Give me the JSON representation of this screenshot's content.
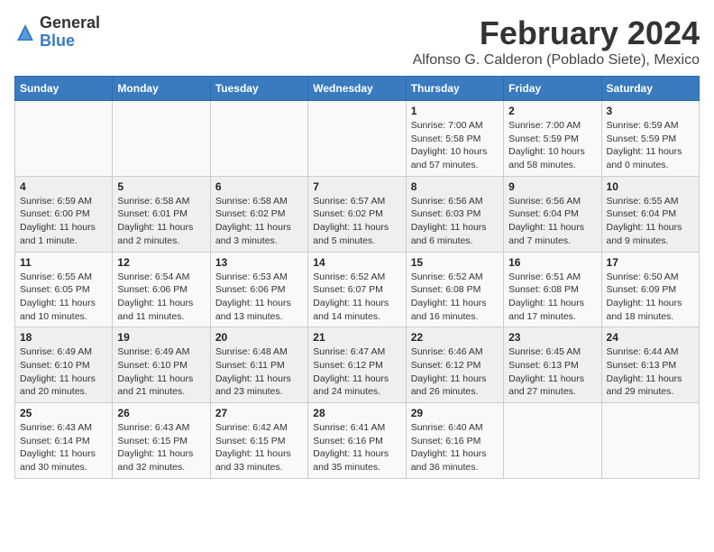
{
  "header": {
    "logo_line1": "General",
    "logo_line2": "Blue",
    "title": "February 2024",
    "subtitle": "Alfonso G. Calderon (Poblado Siete), Mexico"
  },
  "days_of_week": [
    "Sunday",
    "Monday",
    "Tuesday",
    "Wednesday",
    "Thursday",
    "Friday",
    "Saturday"
  ],
  "weeks": [
    [
      {
        "day": "",
        "info": ""
      },
      {
        "day": "",
        "info": ""
      },
      {
        "day": "",
        "info": ""
      },
      {
        "day": "",
        "info": ""
      },
      {
        "day": "1",
        "info": "Sunrise: 7:00 AM\nSunset: 5:58 PM\nDaylight: 10 hours\nand 57 minutes."
      },
      {
        "day": "2",
        "info": "Sunrise: 7:00 AM\nSunset: 5:59 PM\nDaylight: 10 hours\nand 58 minutes."
      },
      {
        "day": "3",
        "info": "Sunrise: 6:59 AM\nSunset: 5:59 PM\nDaylight: 11 hours\nand 0 minutes."
      }
    ],
    [
      {
        "day": "4",
        "info": "Sunrise: 6:59 AM\nSunset: 6:00 PM\nDaylight: 11 hours\nand 1 minute."
      },
      {
        "day": "5",
        "info": "Sunrise: 6:58 AM\nSunset: 6:01 PM\nDaylight: 11 hours\nand 2 minutes."
      },
      {
        "day": "6",
        "info": "Sunrise: 6:58 AM\nSunset: 6:02 PM\nDaylight: 11 hours\nand 3 minutes."
      },
      {
        "day": "7",
        "info": "Sunrise: 6:57 AM\nSunset: 6:02 PM\nDaylight: 11 hours\nand 5 minutes."
      },
      {
        "day": "8",
        "info": "Sunrise: 6:56 AM\nSunset: 6:03 PM\nDaylight: 11 hours\nand 6 minutes."
      },
      {
        "day": "9",
        "info": "Sunrise: 6:56 AM\nSunset: 6:04 PM\nDaylight: 11 hours\nand 7 minutes."
      },
      {
        "day": "10",
        "info": "Sunrise: 6:55 AM\nSunset: 6:04 PM\nDaylight: 11 hours\nand 9 minutes."
      }
    ],
    [
      {
        "day": "11",
        "info": "Sunrise: 6:55 AM\nSunset: 6:05 PM\nDaylight: 11 hours\nand 10 minutes."
      },
      {
        "day": "12",
        "info": "Sunrise: 6:54 AM\nSunset: 6:06 PM\nDaylight: 11 hours\nand 11 minutes."
      },
      {
        "day": "13",
        "info": "Sunrise: 6:53 AM\nSunset: 6:06 PM\nDaylight: 11 hours\nand 13 minutes."
      },
      {
        "day": "14",
        "info": "Sunrise: 6:52 AM\nSunset: 6:07 PM\nDaylight: 11 hours\nand 14 minutes."
      },
      {
        "day": "15",
        "info": "Sunrise: 6:52 AM\nSunset: 6:08 PM\nDaylight: 11 hours\nand 16 minutes."
      },
      {
        "day": "16",
        "info": "Sunrise: 6:51 AM\nSunset: 6:08 PM\nDaylight: 11 hours\nand 17 minutes."
      },
      {
        "day": "17",
        "info": "Sunrise: 6:50 AM\nSunset: 6:09 PM\nDaylight: 11 hours\nand 18 minutes."
      }
    ],
    [
      {
        "day": "18",
        "info": "Sunrise: 6:49 AM\nSunset: 6:10 PM\nDaylight: 11 hours\nand 20 minutes."
      },
      {
        "day": "19",
        "info": "Sunrise: 6:49 AM\nSunset: 6:10 PM\nDaylight: 11 hours\nand 21 minutes."
      },
      {
        "day": "20",
        "info": "Sunrise: 6:48 AM\nSunset: 6:11 PM\nDaylight: 11 hours\nand 23 minutes."
      },
      {
        "day": "21",
        "info": "Sunrise: 6:47 AM\nSunset: 6:12 PM\nDaylight: 11 hours\nand 24 minutes."
      },
      {
        "day": "22",
        "info": "Sunrise: 6:46 AM\nSunset: 6:12 PM\nDaylight: 11 hours\nand 26 minutes."
      },
      {
        "day": "23",
        "info": "Sunrise: 6:45 AM\nSunset: 6:13 PM\nDaylight: 11 hours\nand 27 minutes."
      },
      {
        "day": "24",
        "info": "Sunrise: 6:44 AM\nSunset: 6:13 PM\nDaylight: 11 hours\nand 29 minutes."
      }
    ],
    [
      {
        "day": "25",
        "info": "Sunrise: 6:43 AM\nSunset: 6:14 PM\nDaylight: 11 hours\nand 30 minutes."
      },
      {
        "day": "26",
        "info": "Sunrise: 6:43 AM\nSunset: 6:15 PM\nDaylight: 11 hours\nand 32 minutes."
      },
      {
        "day": "27",
        "info": "Sunrise: 6:42 AM\nSunset: 6:15 PM\nDaylight: 11 hours\nand 33 minutes."
      },
      {
        "day": "28",
        "info": "Sunrise: 6:41 AM\nSunset: 6:16 PM\nDaylight: 11 hours\nand 35 minutes."
      },
      {
        "day": "29",
        "info": "Sunrise: 6:40 AM\nSunset: 6:16 PM\nDaylight: 11 hours\nand 36 minutes."
      },
      {
        "day": "",
        "info": ""
      },
      {
        "day": "",
        "info": ""
      }
    ]
  ]
}
